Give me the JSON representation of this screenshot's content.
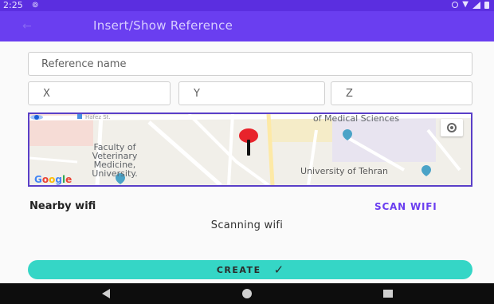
{
  "status_bar": {
    "time": "2:25",
    "notification_icon": "sync-icon",
    "icons": [
      "location-icon",
      "wifi-icon",
      "signal-icon",
      "battery-icon"
    ]
  },
  "app_bar": {
    "title": "Insert/Show Reference",
    "background_color": "#6a3ef0"
  },
  "form": {
    "reference_name_placeholder": "Reference name",
    "x_placeholder": "X",
    "y_placeholder": "Y",
    "z_placeholder": "Z"
  },
  "map": {
    "labels": {
      "faculty": "Faculty of Veterinary Medicine, University.",
      "medical": "of Medical Sciences",
      "tehran": "University of Tehran",
      "hafez": "Hafez St."
    },
    "logo_parts": [
      "G",
      "o",
      "o",
      "g",
      "l",
      "e"
    ],
    "marker": "red-pin"
  },
  "wifi": {
    "nearby_label": "Nearby wifi",
    "scan_button": "SCAN WIFI",
    "status_text": "Scanning wifi"
  },
  "create_button": {
    "label": "CREATE",
    "color": "#35d6c6"
  },
  "nav_bar": {
    "icons": [
      "back-icon",
      "home-icon",
      "recents-icon"
    ]
  }
}
